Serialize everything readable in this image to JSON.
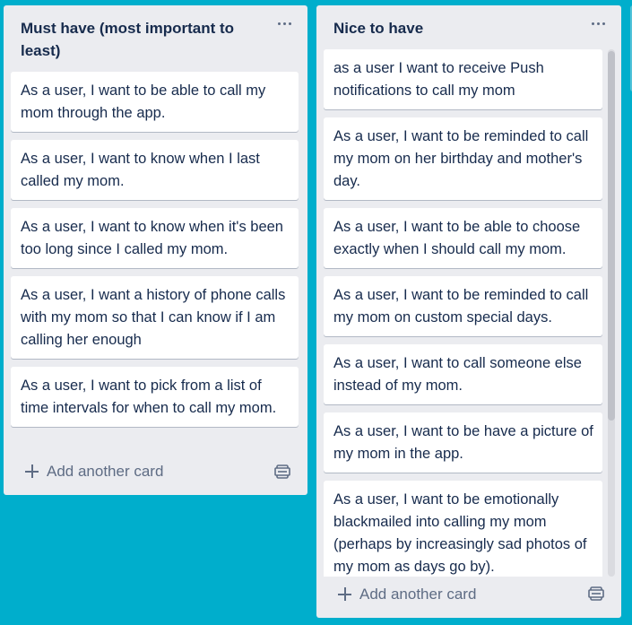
{
  "lists": [
    {
      "title": "Must have (most important to least)",
      "cards": [
        "As a user, I want to be able to call my mom through the app.",
        "As a user, I want to know when I last called my mom.",
        "As a user, I want to know when it's been too long since I called my mom.",
        "As a user, I want a history of phone calls with my mom so that I can know if I am calling her enough",
        "As a user, I want to pick from a list of time intervals for when to call my mom."
      ],
      "add_card_label": "Add another card"
    },
    {
      "title": "Nice to have",
      "cards": [
        "as a user I want to receive Push notifications to call my mom",
        "As a user, I want to be reminded to call my mom on her birthday and mother's day.",
        "As a user, I want to be able to choose exactly when I should call my mom.",
        "As a user, I want to be reminded to call my mom on custom special days.",
        "As a user, I want to call someone else instead of my mom.",
        "As a user, I want to be have a picture of my mom in the app.",
        "As a user, I want to be emotionally blackmailed into calling my mom (perhaps by increasingly sad photos of my mom as days go by)."
      ],
      "add_card_label": "Add another card"
    }
  ],
  "icons": {
    "list_menu": "more-horizontal-icon",
    "add": "plus-icon",
    "template": "card-template-icon"
  },
  "colors": {
    "board_background": "#00AECC",
    "list_background": "#EBECF0",
    "card_background": "#FFFFFF",
    "text": "#172B4D",
    "muted_text": "#5E6C84"
  }
}
